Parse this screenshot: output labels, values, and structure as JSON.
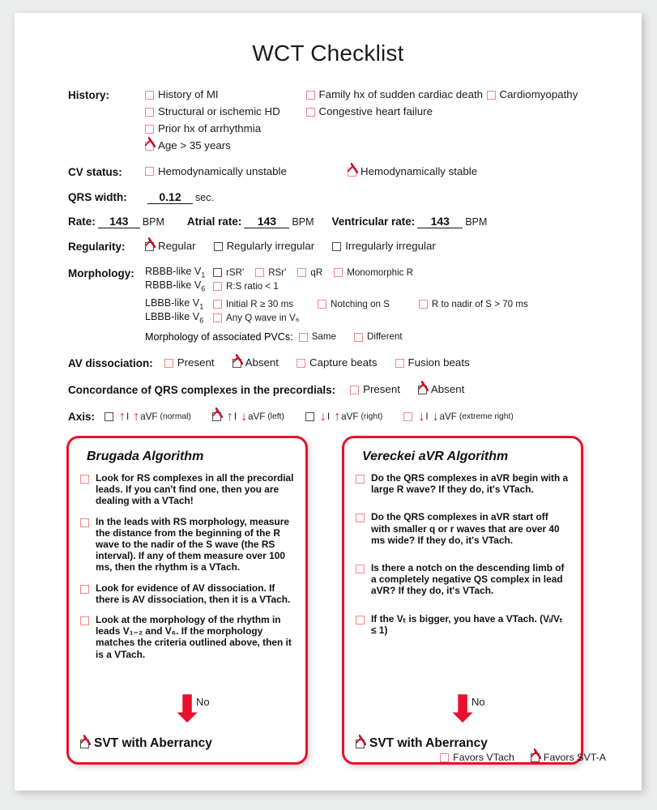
{
  "page": {
    "title": "WCT Checklist",
    "accent_red": "#e8112d",
    "checkbox_pink": "#f2868a",
    "check_red": "#c9162b"
  },
  "history": {
    "label": "History:",
    "column1": [
      {
        "text": "History of MI",
        "checked": false,
        "border": "pink"
      },
      {
        "text": "Structural or ischemic HD",
        "checked": false,
        "border": "pink"
      },
      {
        "text": "Prior hx of arrhythmia",
        "checked": false,
        "border": "pink"
      },
      {
        "text": "Age > 35 years",
        "checked": true,
        "border": "pink"
      }
    ],
    "column2": [
      {
        "text": "Family hx of sudden cardiac death",
        "checked": false,
        "border": "pink"
      },
      {
        "text": "Cardiomyopathy",
        "checked": false,
        "border": "pink"
      },
      {
        "text": "Congestive heart failure",
        "checked": false,
        "border": "pink"
      }
    ]
  },
  "cv_status": {
    "label": "CV status:",
    "options": [
      {
        "text": "Hemodynamically unstable",
        "checked": false,
        "border": "pink"
      },
      {
        "text": "Hemodynamically stable",
        "checked": true,
        "border": "pink"
      }
    ]
  },
  "qrs_width": {
    "label": "QRS width:",
    "value": "0.12",
    "unit": "sec."
  },
  "rates": {
    "rate_label": "Rate:",
    "rate_value": "143",
    "rate_unit": "BPM",
    "atrial_label": "Atrial rate:",
    "atrial_value": "143",
    "atrial_unit": "BPM",
    "ventricular_label": "Ventricular rate:",
    "ventricular_value": "143",
    "ventricular_unit": "BPM"
  },
  "regularity": {
    "label": "Regularity:",
    "options": [
      {
        "text": "Regular",
        "checked": true,
        "border": "dark"
      },
      {
        "text": "Regularly irregular",
        "checked": false,
        "border": "dark"
      },
      {
        "text": "Irregularly irregular",
        "checked": false,
        "border": "dark"
      }
    ]
  },
  "morphology": {
    "label": "Morphology:",
    "rows": [
      {
        "lead_prefix": "RBBB-like V",
        "lead_sub": "1",
        "options": [
          {
            "text": "rSR'",
            "checked": false,
            "border": "dark"
          },
          {
            "text": "RSr'",
            "checked": false,
            "border": "pink"
          },
          {
            "text": "qR",
            "checked": false,
            "border": "pink"
          },
          {
            "text": "Monomorphic R",
            "checked": false,
            "border": "pink"
          }
        ]
      },
      {
        "lead_prefix": "RBBB-like V",
        "lead_sub": "6",
        "options": [
          {
            "text": "R:S ratio < 1",
            "checked": false,
            "border": "pink"
          }
        ]
      },
      {
        "lead_prefix": "LBBB-like V",
        "lead_sub": "1",
        "options": [
          {
            "text": "Initial R ≥ 30 ms",
            "checked": false,
            "border": "pink"
          },
          {
            "text": "Notching on S",
            "checked": false,
            "border": "pink"
          },
          {
            "text": "R to nadir of S > 70 ms",
            "checked": false,
            "border": "pink"
          }
        ]
      },
      {
        "lead_prefix": "LBBB-like V",
        "lead_sub": "6",
        "options": [
          {
            "text": "Any Q wave in V₆",
            "checked": false,
            "border": "pink"
          }
        ]
      }
    ],
    "pvc_label": "Morphology of associated PVCs:",
    "pvc_options": [
      {
        "text": "Same",
        "checked": false,
        "border": "pink"
      },
      {
        "text": "Different",
        "checked": false,
        "border": "pink"
      }
    ]
  },
  "av_dissociation": {
    "label": "AV dissociation:",
    "options": [
      {
        "text": "Present",
        "checked": false,
        "border": "pink"
      },
      {
        "text": "Absent",
        "checked": true,
        "border": "dark"
      },
      {
        "text": "Capture beats",
        "checked": false,
        "border": "pink"
      },
      {
        "text": "Fusion beats",
        "checked": false,
        "border": "pink"
      }
    ]
  },
  "concordance": {
    "label": "Concordance of QRS complexes in the precordials:",
    "options": [
      {
        "text": "Present",
        "checked": false,
        "border": "pink"
      },
      {
        "text": "Absent",
        "checked": true,
        "border": "dark"
      }
    ]
  },
  "axis": {
    "label": "Axis:",
    "groups": [
      {
        "checked": false,
        "border": "dark",
        "lead_1_arrow": "up",
        "lead_1": "I",
        "lead_2_arrow": "up",
        "lead_2": "aVF",
        "note": "(normal)"
      },
      {
        "checked": true,
        "border": "dark",
        "lead_1_arrow": "up",
        "lead_1": "I",
        "lead_2_arrow": "down",
        "lead_2": "aVF",
        "note": "(left)"
      },
      {
        "checked": false,
        "border": "dark",
        "lead_1_arrow": "down",
        "lead_1": "I",
        "lead_2_arrow": "up",
        "lead_2": "aVF",
        "note": "(right)"
      },
      {
        "checked": false,
        "border": "pink",
        "lead_1_arrow": "down",
        "lead_1": "I",
        "lead_2_arrow": "down",
        "lead_2": "aVF",
        "note": "(extreme right)"
      }
    ]
  },
  "algorithms": [
    {
      "title": "Brugada Algorithm",
      "items": [
        {
          "text": "Look for RS complexes in all the precordial leads.  If you can't find one, then you are dealing with a VTach!",
          "checked": false
        },
        {
          "text": "In the leads with RS morphology, measure the distance from the beginning of the R wave to the nadir of the S wave (the RS interval).  If any of them measure over 100 ms, then the rhythm is a VTach.",
          "checked": false
        },
        {
          "text": "Look for evidence of AV dissociation.  If there is AV dissociation, then it is a VTach.",
          "checked": false
        },
        {
          "text": "Look at the morphology of the rhythm in leads V₁₋₂  and V₆. If the morphology matches the criteria outlined above, then it is a VTach.",
          "checked": false
        }
      ],
      "arrow_label": "No",
      "conclusion": "SVT with Aberrancy",
      "conclusion_checked": true
    },
    {
      "title": "Vereckei aVR Algorithm",
      "items": [
        {
          "text": "Do the QRS complexes in aVR begin with a large R wave?  If they do, it's VTach.",
          "checked": false
        },
        {
          "text": "Do the QRS complexes in aVR start off with smaller q or r waves that are over 40 ms wide?  If they do, it's VTach.",
          "checked": false
        },
        {
          "text": "Is there a notch on the descending limb of a completely negative QS complex in lead aVR? If they do, it's VTach.",
          "checked": false
        },
        {
          "text": "If the Vₜ is bigger, you have a VTach. (Vᵢ/Vₜ ≤ 1)",
          "checked": false
        }
      ],
      "arrow_label": "No",
      "conclusion": "SVT with Aberrancy",
      "conclusion_checked": true
    }
  ],
  "footer": {
    "options": [
      {
        "text": "Favors VTach",
        "checked": false,
        "border": "pink"
      },
      {
        "text": "Favors SVT-A",
        "checked": true,
        "border": "dark"
      }
    ]
  }
}
